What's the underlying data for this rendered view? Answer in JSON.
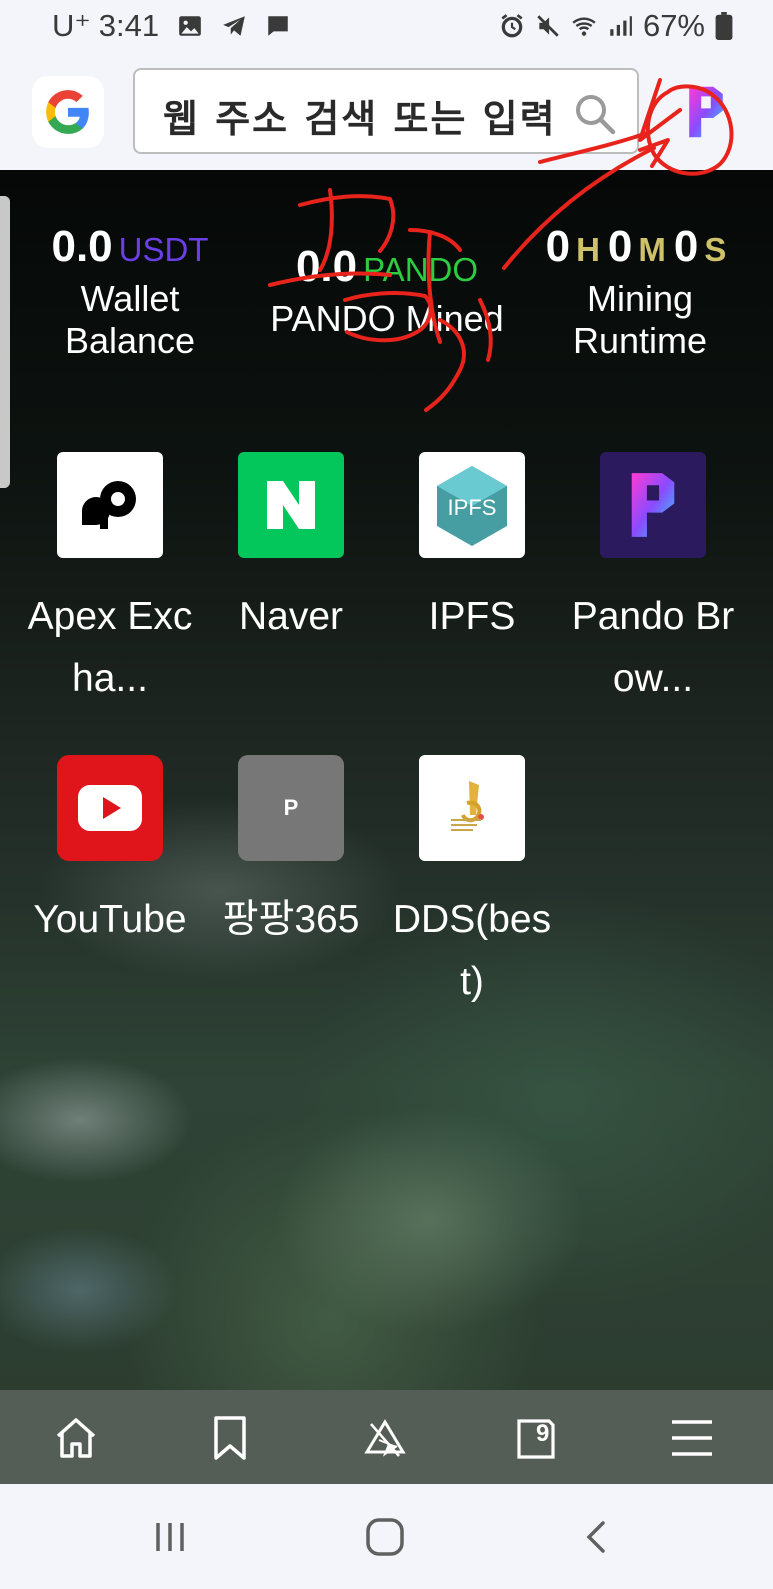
{
  "status_bar": {
    "carrier": "U⁺",
    "time": "3:41",
    "battery": "67%"
  },
  "toolbar": {
    "search_placeholder": "웹 주소 검색 또는 입력"
  },
  "stats": {
    "wallet": {
      "value": "0.0",
      "unit": "USDT",
      "label": "Wallet Balance"
    },
    "mined": {
      "value": "0.0",
      "unit": "PANDO",
      "label": "PANDO Mined"
    },
    "runtime": {
      "h": "0",
      "h_unit": "H",
      "m": "0",
      "m_unit": "M",
      "s": "0",
      "s_unit": "S",
      "label": "Mining Runtime"
    }
  },
  "apps": [
    {
      "label": "Apex Excha...",
      "icon": "apex-icon"
    },
    {
      "label": "Naver",
      "icon": "naver-icon"
    },
    {
      "label": "IPFS",
      "icon": "ipfs-icon",
      "icon_text": "IPFS"
    },
    {
      "label": "Pando Brow...",
      "icon": "pando-icon"
    },
    {
      "label": "YouTube",
      "icon": "youtube-icon"
    },
    {
      "label": "팡팡365",
      "icon": "placeholder-p-icon",
      "icon_text": "P"
    },
    {
      "label": "DDS(best)",
      "icon": "dds-icon"
    }
  ],
  "bottom_nav": {
    "tabs_count": "9"
  },
  "colors": {
    "usdt": "#6a3fe6",
    "pando": "#2ecc40",
    "runtime_unit": "#cfc16a",
    "annotation": "#e8231c"
  }
}
